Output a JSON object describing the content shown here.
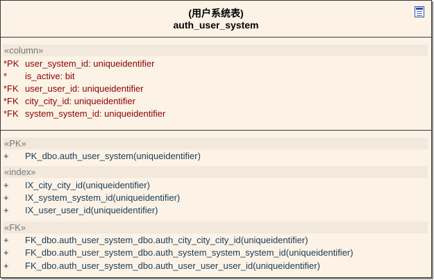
{
  "entity": {
    "chinese_title": "(用户系统表)",
    "table_name": "auth_user_system",
    "icon": "table-icon"
  },
  "columns": {
    "label": "«column»",
    "items": [
      {
        "tag": "*PK",
        "text": "user_system_id:  uniqueidentifier"
      },
      {
        "tag": "*",
        "text": "is_active:  bit"
      },
      {
        "tag": "*FK",
        "text": "user_user_id:  uniqueidentifier"
      },
      {
        "tag": "*FK",
        "text": "city_city_id:  uniqueidentifier"
      },
      {
        "tag": "*FK",
        "text": "system_system_id:  uniqueidentifier"
      }
    ]
  },
  "pk": {
    "label": "«PK»",
    "items": [
      {
        "tag": "+",
        "text": "PK_dbo.auth_user_system(uniqueidentifier)"
      }
    ]
  },
  "index": {
    "label": "«index»",
    "items": [
      {
        "tag": "+",
        "text": "IX_city_city_id(uniqueidentifier)"
      },
      {
        "tag": "+",
        "text": "IX_system_system_id(uniqueidentifier)"
      },
      {
        "tag": "+",
        "text": "IX_user_user_id(uniqueidentifier)"
      }
    ]
  },
  "fk": {
    "label": "«FK»",
    "items": [
      {
        "tag": "+",
        "text": "FK_dbo.auth_user_system_dbo.auth_city_city_city_id(uniqueidentifier)"
      },
      {
        "tag": "+",
        "text": "FK_dbo.auth_user_system_dbo.auth_system_system_system_id(uniqueidentifier)"
      },
      {
        "tag": "+",
        "text": "FK_dbo.auth_user_system_dbo.auth_user_user_user_id(uniqueidentifier)"
      }
    ]
  },
  "colors": {
    "column_text": "#8b0000",
    "operation_text": "#1a3a57",
    "entity_fill": "#fcf3e6"
  }
}
